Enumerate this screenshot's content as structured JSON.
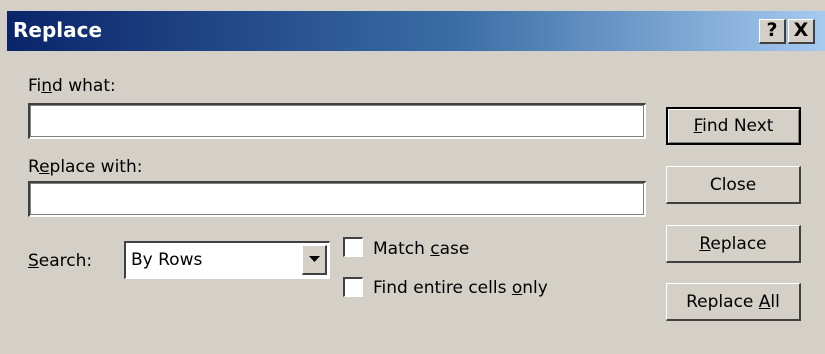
{
  "window": {
    "title": "Replace",
    "help_glyph": "?",
    "close_glyph": "X"
  },
  "find": {
    "label_pre": "Fi",
    "label_u": "n",
    "label_post": "d what:",
    "value": ""
  },
  "replace": {
    "label_pre": "R",
    "label_u": "e",
    "label_post": "place with:",
    "value": ""
  },
  "search": {
    "label_u": "S",
    "label_post": "earch:",
    "selected": "By Rows"
  },
  "options": {
    "match_case": {
      "pre": "Match ",
      "u": "c",
      "post": "ase",
      "checked": false
    },
    "entire_cells": {
      "pre": "Find entire cells ",
      "u": "o",
      "post": "nly",
      "checked": false
    }
  },
  "buttons": {
    "find_next": {
      "u": "F",
      "post": "ind Next"
    },
    "close": {
      "label": "Close"
    },
    "replace": {
      "u": "R",
      "post": "eplace"
    },
    "replace_all": {
      "pre": "Replace ",
      "u": "A",
      "post": "ll"
    }
  }
}
